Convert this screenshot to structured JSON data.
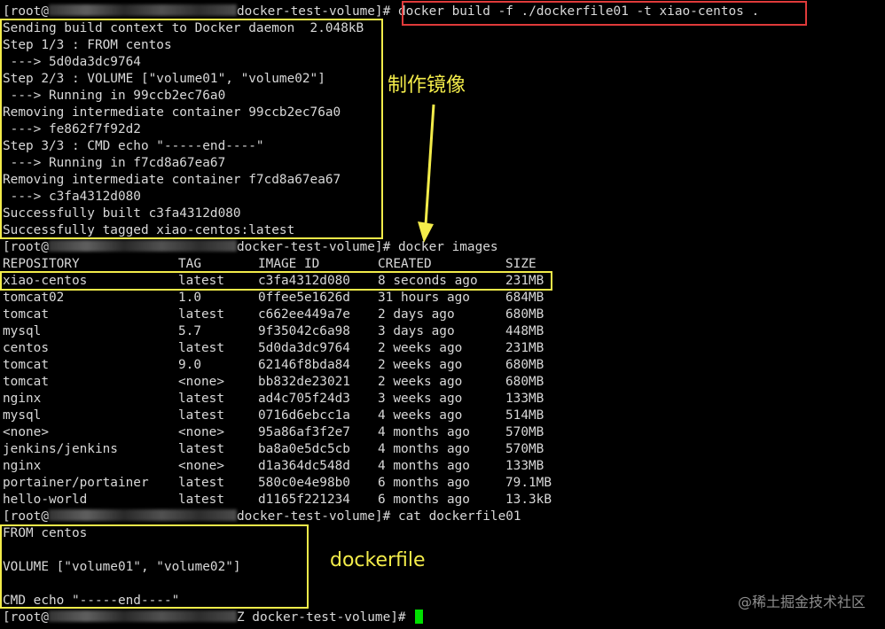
{
  "prompt": {
    "prefix": "[root@",
    "suffix": "docker-test-volume]#",
    "final_suffix": "Z docker-test-volume]#"
  },
  "commands": {
    "build": "docker build -f ./dockerfile01 -t xiao-centos .",
    "images": "docker images",
    "cat": "cat dockerfile01"
  },
  "build_output": [
    "Sending build context to Docker daemon  2.048kB",
    "Step 1/3 : FROM centos",
    " ---> 5d0da3dc9764",
    "Step 2/3 : VOLUME [\"volume01\", \"volume02\"]",
    " ---> Running in 99ccb2ec76a0",
    "Removing intermediate container 99ccb2ec76a0",
    " ---> fe862f7f92d2",
    "Step 3/3 : CMD echo \"-----end----\"",
    " ---> Running in f7cd8a67ea67",
    "Removing intermediate container f7cd8a67ea67",
    " ---> c3fa4312d080",
    "Successfully built c3fa4312d080",
    "Successfully tagged xiao-centos:latest"
  ],
  "images_table": {
    "headers": [
      "REPOSITORY",
      "TAG",
      "IMAGE ID",
      "CREATED",
      "SIZE"
    ],
    "rows": [
      [
        "xiao-centos",
        "latest",
        "c3fa4312d080",
        "8 seconds ago",
        "231MB"
      ],
      [
        "tomcat02",
        "1.0",
        "0ffee5e1626d",
        "31 hours ago",
        "684MB"
      ],
      [
        "tomcat",
        "latest",
        "c662ee449a7e",
        "2 days ago",
        "680MB"
      ],
      [
        "mysql",
        "5.7",
        "9f35042c6a98",
        "3 days ago",
        "448MB"
      ],
      [
        "centos",
        "latest",
        "5d0da3dc9764",
        "2 weeks ago",
        "231MB"
      ],
      [
        "tomcat",
        "9.0",
        "62146f8bda84",
        "2 weeks ago",
        "680MB"
      ],
      [
        "tomcat",
        "<none>",
        "bb832de23021",
        "2 weeks ago",
        "680MB"
      ],
      [
        "nginx",
        "latest",
        "ad4c705f24d3",
        "3 weeks ago",
        "133MB"
      ],
      [
        "mysql",
        "latest",
        "0716d6ebcc1a",
        "4 weeks ago",
        "514MB"
      ],
      [
        "<none>",
        "<none>",
        "95a86af3f2e7",
        "4 months ago",
        "570MB"
      ],
      [
        "jenkins/jenkins",
        "latest",
        "ba8a0e5dc5cb",
        "4 months ago",
        "570MB"
      ],
      [
        "nginx",
        "<none>",
        "d1a364dc548d",
        "4 months ago",
        "133MB"
      ],
      [
        "portainer/portainer",
        "latest",
        "580c0e4e98b0",
        "6 months ago",
        "79.1MB"
      ],
      [
        "hello-world",
        "latest",
        "d1165f221234",
        "6 months ago",
        "13.3kB"
      ]
    ]
  },
  "dockerfile_content": [
    "FROM centos",
    "",
    "VOLUME [\"volume01\", \"volume02\"]",
    "",
    "CMD echo \"-----end----\""
  ],
  "annotations": {
    "build_label": "制作镜像",
    "dockerfile_label": "dockerfile"
  },
  "watermark": "@稀土掘金技术社区",
  "colors": {
    "background": "#000000",
    "text": "#d8d8d8",
    "highlight_red": "#e03a3a",
    "highlight_yellow": "#f3ec4a",
    "cursor": "#00e000"
  }
}
